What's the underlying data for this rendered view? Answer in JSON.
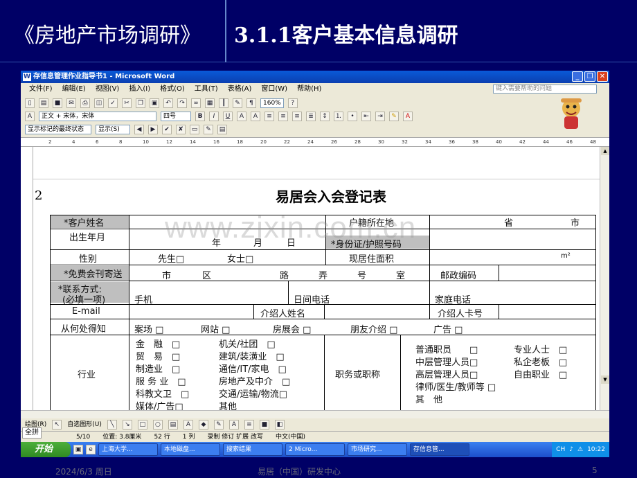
{
  "slide": {
    "title_left": "《房地产市场调研》",
    "title_right": "3.1.1客户基本信息调研",
    "footer_left": "2024/6/3 周日",
    "footer_mid": "易居（中国）研发中心",
    "footer_right": "5"
  },
  "window": {
    "title": "存信息管理作业指导书1 - Microsoft Word",
    "controls": [
      "_",
      "❐",
      "✕"
    ]
  },
  "menu": [
    "文件(F)",
    "编辑(E)",
    "视图(V)",
    "插入(I)",
    "格式(O)",
    "工具(T)",
    "表格(A)",
    "窗口(W)",
    "帮助(H)"
  ],
  "help_placeholder": "键入需要帮助的问题",
  "toolbar": {
    "zoom": "160%",
    "style": "正文 + 宋体，宋体",
    "font_size": "四号",
    "bold": "B",
    "italic": "I",
    "underline": "U",
    "track_label": "显示标记的最终状态",
    "show_label": "显示(S)"
  },
  "ruler": [
    "2",
    "4",
    "6",
    "8",
    "10",
    "12",
    "14",
    "16",
    "18",
    "20",
    "22",
    "24",
    "26",
    "28",
    "30",
    "32",
    "34",
    "36",
    "38",
    "40",
    "42",
    "44",
    "46",
    "48"
  ],
  "document": {
    "page_marker": "2",
    "form_title": "易居会入会登记表",
    "watermark": "www.zixin.com.cn",
    "labels": {
      "name": "*客户姓名",
      "origin": "户籍所在地",
      "province": "省",
      "city": "市",
      "birth": "出生年月",
      "year": "年",
      "month": "月",
      "day": "日",
      "id": "*身份证/护照号码",
      "gender": "性别",
      "mr": "先生□",
      "ms": "女士□",
      "area": "现居住面积",
      "area_unit": "m²",
      "address": "*免费会刊寄送",
      "addr_city": "市",
      "addr_district": "区",
      "addr_road": "路",
      "addr_lane": "弄",
      "addr_no": "号",
      "addr_room": "室",
      "postcode": "邮政编码",
      "contact": "*联系方式:",
      "contact_note": "(必填一项)",
      "mobile": "手机",
      "day_phone": "日间电话",
      "home_phone": "家庭电话",
      "email": "E-mail",
      "referrer": "介绍人姓名",
      "referrer_card": "介绍人卡号",
      "source": "从何处得知",
      "industry": "行业",
      "position": "职务或职称"
    },
    "sources": [
      "案场 □",
      "网站 □",
      "房展会 □",
      "朋友介绍 □",
      "广告 □"
    ],
    "industries_left": [
      "金　融　□",
      "贸　易　□",
      "制造业　□",
      "服 务 业　□",
      "科教文卫　□",
      "媒体/广告□"
    ],
    "industries_right": [
      "机关/社团　□",
      "建筑/装潢业　□",
      "通信/IT/家电　□",
      "房地产及中介　□",
      "交通/运输/物流□",
      "其他"
    ],
    "positions_left": [
      "普通职员　　□",
      "中层管理人员□",
      "高层管理人员□",
      "律师/医生/教师等 □",
      "其　他"
    ],
    "positions_right": [
      "专业人士　□",
      "私企老板　□",
      "自由职业　□"
    ]
  },
  "drawbar": [
    "绘图(R)",
    "自选图形(U)"
  ],
  "status": {
    "page": "5/10",
    "position": "位置: 3.8厘米",
    "line": "52 行",
    "col": "1 列",
    "modes": "录制 修订 扩展 改写",
    "lang": "中文(中国)"
  },
  "ime": "全拼",
  "taskbar": {
    "start": "开始",
    "tasks": [
      "上海大学...",
      "本地磁盘...",
      "搜索结果",
      "2 Micro...",
      "市场研究...",
      "存信息管..."
    ],
    "lang": "CH",
    "time": "10:22"
  }
}
